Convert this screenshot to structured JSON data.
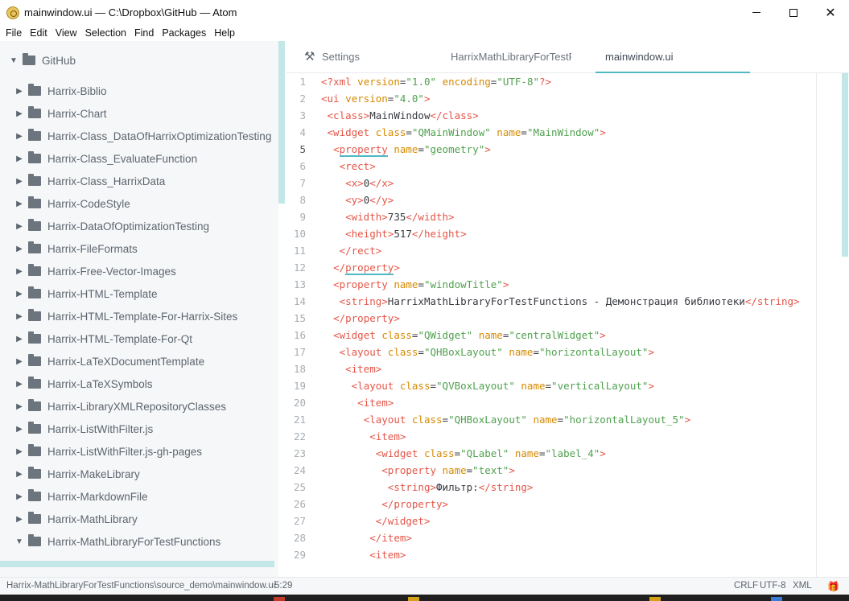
{
  "window": {
    "title": "mainwindow.ui — C:\\Dropbox\\GitHub — Atom",
    "min_label": "",
    "max_label": "",
    "close_label": "✕"
  },
  "menu": [
    "File",
    "Edit",
    "View",
    "Selection",
    "Find",
    "Packages",
    "Help"
  ],
  "tree": {
    "root": "GitHub",
    "items": [
      {
        "label": "Harrix-Biblio",
        "expanded": false
      },
      {
        "label": "Harrix-Chart",
        "expanded": false
      },
      {
        "label": "Harrix-Class_DataOfHarrixOptimizationTesting",
        "expanded": false
      },
      {
        "label": "Harrix-Class_EvaluateFunction",
        "expanded": false
      },
      {
        "label": "Harrix-Class_HarrixData",
        "expanded": false
      },
      {
        "label": "Harrix-CodeStyle",
        "expanded": false
      },
      {
        "label": "Harrix-DataOfOptimizationTesting",
        "expanded": false
      },
      {
        "label": "Harrix-FileFormats",
        "expanded": false
      },
      {
        "label": "Harrix-Free-Vector-Images",
        "expanded": false
      },
      {
        "label": "Harrix-HTML-Template",
        "expanded": false
      },
      {
        "label": "Harrix-HTML-Template-For-Harrix-Sites",
        "expanded": false
      },
      {
        "label": "Harrix-HTML-Template-For-Qt",
        "expanded": false
      },
      {
        "label": "Harrix-LaTeXDocumentTemplate",
        "expanded": false
      },
      {
        "label": "Harrix-LaTeXSymbols",
        "expanded": false
      },
      {
        "label": "Harrix-LibraryXMLRepositoryClasses",
        "expanded": false
      },
      {
        "label": "Harrix-ListWithFilter.js",
        "expanded": false
      },
      {
        "label": "Harrix-ListWithFilter.js-gh-pages",
        "expanded": false
      },
      {
        "label": "Harrix-MakeLibrary",
        "expanded": false
      },
      {
        "label": "Harrix-MarkdownFile",
        "expanded": false
      },
      {
        "label": "Harrix-MathLibrary",
        "expanded": false
      },
      {
        "label": "Harrix-MathLibraryForTestFunctions",
        "expanded": true
      }
    ]
  },
  "tabs": [
    {
      "label": "Settings",
      "icon": "tools-icon",
      "active": false
    },
    {
      "label": "HarrixMathLibraryForTestF",
      "active": false
    },
    {
      "label": "mainwindow.ui",
      "active": true
    }
  ],
  "editor": {
    "cursor_line": 5,
    "lines": [
      [
        {
          "t": "tag",
          "v": "<?xml"
        },
        {
          "t": "text",
          "v": " "
        },
        {
          "t": "attr",
          "v": "version"
        },
        {
          "t": "text",
          "v": "="
        },
        {
          "t": "str",
          "v": "\"1.0\""
        },
        {
          "t": "text",
          "v": " "
        },
        {
          "t": "attr",
          "v": "encoding"
        },
        {
          "t": "text",
          "v": "="
        },
        {
          "t": "str",
          "v": "\"UTF-8\""
        },
        {
          "t": "tag",
          "v": "?>"
        }
      ],
      [
        {
          "t": "tag",
          "v": "<ui"
        },
        {
          "t": "text",
          "v": " "
        },
        {
          "t": "attr",
          "v": "version"
        },
        {
          "t": "text",
          "v": "="
        },
        {
          "t": "str",
          "v": "\"4.0\""
        },
        {
          "t": "tag",
          "v": ">"
        }
      ],
      [
        {
          "t": "text",
          "v": " "
        },
        {
          "t": "tag",
          "v": "<class>"
        },
        {
          "t": "text",
          "v": "MainWindow"
        },
        {
          "t": "tag",
          "v": "</class>"
        }
      ],
      [
        {
          "t": "text",
          "v": " "
        },
        {
          "t": "tag",
          "v": "<widget"
        },
        {
          "t": "text",
          "v": " "
        },
        {
          "t": "attr",
          "v": "class"
        },
        {
          "t": "text",
          "v": "="
        },
        {
          "t": "str",
          "v": "\"QMainWindow\""
        },
        {
          "t": "text",
          "v": " "
        },
        {
          "t": "attr",
          "v": "name"
        },
        {
          "t": "text",
          "v": "="
        },
        {
          "t": "str",
          "v": "\"MainWindow\""
        },
        {
          "t": "tag",
          "v": ">"
        }
      ],
      [
        {
          "t": "text",
          "v": "  "
        },
        {
          "t": "tag",
          "v": "<"
        },
        {
          "t": "tag",
          "v": "property",
          "hl": true
        },
        {
          "t": "text",
          "v": " "
        },
        {
          "t": "attr",
          "v": "name"
        },
        {
          "t": "text",
          "v": "="
        },
        {
          "t": "str",
          "v": "\"geometry\""
        },
        {
          "t": "tag",
          "v": ">"
        }
      ],
      [
        {
          "t": "text",
          "v": "   "
        },
        {
          "t": "tag",
          "v": "<rect>"
        }
      ],
      [
        {
          "t": "text",
          "v": "    "
        },
        {
          "t": "tag",
          "v": "<x>"
        },
        {
          "t": "text",
          "v": "0"
        },
        {
          "t": "tag",
          "v": "</x>"
        }
      ],
      [
        {
          "t": "text",
          "v": "    "
        },
        {
          "t": "tag",
          "v": "<y>"
        },
        {
          "t": "text",
          "v": "0"
        },
        {
          "t": "tag",
          "v": "</y>"
        }
      ],
      [
        {
          "t": "text",
          "v": "    "
        },
        {
          "t": "tag",
          "v": "<width>"
        },
        {
          "t": "text",
          "v": "735"
        },
        {
          "t": "tag",
          "v": "</width>"
        }
      ],
      [
        {
          "t": "text",
          "v": "    "
        },
        {
          "t": "tag",
          "v": "<height>"
        },
        {
          "t": "text",
          "v": "517"
        },
        {
          "t": "tag",
          "v": "</height>"
        }
      ],
      [
        {
          "t": "text",
          "v": "   "
        },
        {
          "t": "tag",
          "v": "</rect>"
        }
      ],
      [
        {
          "t": "text",
          "v": "  "
        },
        {
          "t": "tag",
          "v": "</"
        },
        {
          "t": "tag",
          "v": "property",
          "hl": true
        },
        {
          "t": "tag",
          "v": ">"
        }
      ],
      [
        {
          "t": "text",
          "v": "  "
        },
        {
          "t": "tag",
          "v": "<property"
        },
        {
          "t": "text",
          "v": " "
        },
        {
          "t": "attr",
          "v": "name"
        },
        {
          "t": "text",
          "v": "="
        },
        {
          "t": "str",
          "v": "\"windowTitle\""
        },
        {
          "t": "tag",
          "v": ">"
        }
      ],
      [
        {
          "t": "text",
          "v": "   "
        },
        {
          "t": "tag",
          "v": "<string>"
        },
        {
          "t": "text",
          "v": "HarrixMathLibraryForTestFunctions - Демонстрация библиотеки"
        },
        {
          "t": "tag",
          "v": "</string>"
        }
      ],
      [
        {
          "t": "text",
          "v": "  "
        },
        {
          "t": "tag",
          "v": "</property>"
        }
      ],
      [
        {
          "t": "text",
          "v": "  "
        },
        {
          "t": "tag",
          "v": "<widget"
        },
        {
          "t": "text",
          "v": " "
        },
        {
          "t": "attr",
          "v": "class"
        },
        {
          "t": "text",
          "v": "="
        },
        {
          "t": "str",
          "v": "\"QWidget\""
        },
        {
          "t": "text",
          "v": " "
        },
        {
          "t": "attr",
          "v": "name"
        },
        {
          "t": "text",
          "v": "="
        },
        {
          "t": "str",
          "v": "\"centralWidget\""
        },
        {
          "t": "tag",
          "v": ">"
        }
      ],
      [
        {
          "t": "text",
          "v": "   "
        },
        {
          "t": "tag",
          "v": "<layout"
        },
        {
          "t": "text",
          "v": " "
        },
        {
          "t": "attr",
          "v": "class"
        },
        {
          "t": "text",
          "v": "="
        },
        {
          "t": "str",
          "v": "\"QHBoxLayout\""
        },
        {
          "t": "text",
          "v": " "
        },
        {
          "t": "attr",
          "v": "name"
        },
        {
          "t": "text",
          "v": "="
        },
        {
          "t": "str",
          "v": "\"horizontalLayout\""
        },
        {
          "t": "tag",
          "v": ">"
        }
      ],
      [
        {
          "t": "text",
          "v": "    "
        },
        {
          "t": "tag",
          "v": "<item>"
        }
      ],
      [
        {
          "t": "text",
          "v": "     "
        },
        {
          "t": "tag",
          "v": "<layout"
        },
        {
          "t": "text",
          "v": " "
        },
        {
          "t": "attr",
          "v": "class"
        },
        {
          "t": "text",
          "v": "="
        },
        {
          "t": "str",
          "v": "\"QVBoxLayout\""
        },
        {
          "t": "text",
          "v": " "
        },
        {
          "t": "attr",
          "v": "name"
        },
        {
          "t": "text",
          "v": "="
        },
        {
          "t": "str",
          "v": "\"verticalLayout\""
        },
        {
          "t": "tag",
          "v": ">"
        }
      ],
      [
        {
          "t": "text",
          "v": "      "
        },
        {
          "t": "tag",
          "v": "<item>"
        }
      ],
      [
        {
          "t": "text",
          "v": "       "
        },
        {
          "t": "tag",
          "v": "<layout"
        },
        {
          "t": "text",
          "v": " "
        },
        {
          "t": "attr",
          "v": "class"
        },
        {
          "t": "text",
          "v": "="
        },
        {
          "t": "str",
          "v": "\"QHBoxLayout\""
        },
        {
          "t": "text",
          "v": " "
        },
        {
          "t": "attr",
          "v": "name"
        },
        {
          "t": "text",
          "v": "="
        },
        {
          "t": "str",
          "v": "\"horizontalLayout_5\""
        },
        {
          "t": "tag",
          "v": ">"
        }
      ],
      [
        {
          "t": "text",
          "v": "        "
        },
        {
          "t": "tag",
          "v": "<item>"
        }
      ],
      [
        {
          "t": "text",
          "v": "         "
        },
        {
          "t": "tag",
          "v": "<widget"
        },
        {
          "t": "text",
          "v": " "
        },
        {
          "t": "attr",
          "v": "class"
        },
        {
          "t": "text",
          "v": "="
        },
        {
          "t": "str",
          "v": "\"QLabel\""
        },
        {
          "t": "text",
          "v": " "
        },
        {
          "t": "attr",
          "v": "name"
        },
        {
          "t": "text",
          "v": "="
        },
        {
          "t": "str",
          "v": "\"label_4\""
        },
        {
          "t": "tag",
          "v": ">"
        }
      ],
      [
        {
          "t": "text",
          "v": "          "
        },
        {
          "t": "tag",
          "v": "<property"
        },
        {
          "t": "text",
          "v": " "
        },
        {
          "t": "attr",
          "v": "name"
        },
        {
          "t": "text",
          "v": "="
        },
        {
          "t": "str",
          "v": "\"text\""
        },
        {
          "t": "tag",
          "v": ">"
        }
      ],
      [
        {
          "t": "text",
          "v": "           "
        },
        {
          "t": "tag",
          "v": "<string>"
        },
        {
          "t": "text",
          "v": "Фильтр:"
        },
        {
          "t": "tag",
          "v": "</string>"
        }
      ],
      [
        {
          "t": "text",
          "v": "          "
        },
        {
          "t": "tag",
          "v": "</property>"
        }
      ],
      [
        {
          "t": "text",
          "v": "         "
        },
        {
          "t": "tag",
          "v": "</widget>"
        }
      ],
      [
        {
          "t": "text",
          "v": "        "
        },
        {
          "t": "tag",
          "v": "</item>"
        }
      ],
      [
        {
          "t": "text",
          "v": "        "
        },
        {
          "t": "tag",
          "v": "<item>"
        }
      ]
    ]
  },
  "status": {
    "path": "Harrix-MathLibraryForTestFunctions\\source_demo\\mainwindow.ui",
    "position": "5:29",
    "line_ending": "CRLF",
    "encoding": "UTF-8",
    "grammar": "XML"
  },
  "colors": {
    "accent": "#4fb8c2",
    "tag": "#e45649",
    "attr": "#d68a00",
    "string": "#50a14f",
    "tree_text": "#5d6670"
  }
}
